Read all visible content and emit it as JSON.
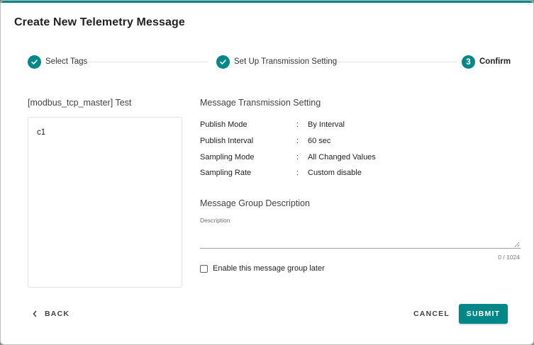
{
  "dialog": {
    "title": "Create New Telemetry Message",
    "accent_color": "#008787"
  },
  "stepper": {
    "steps": [
      {
        "number": "1",
        "label": "Select Tags",
        "state": "completed",
        "icon": "check-icon"
      },
      {
        "number": "2",
        "label": "Set Up Transmission Setting",
        "state": "completed",
        "icon": "check-icon"
      },
      {
        "number": "3",
        "label": "Confirm",
        "state": "active"
      }
    ]
  },
  "tags_panel": {
    "heading": "[modbus_tcp_master] Test",
    "items": [
      "c1"
    ]
  },
  "transmission": {
    "heading": "Message Transmission Setting",
    "rows": [
      {
        "key": "Publish Mode",
        "value": "By Interval"
      },
      {
        "key": "Publish Interval",
        "value": "60 sec"
      },
      {
        "key": "Sampling Mode",
        "value": "All Changed Values"
      },
      {
        "key": "Sampling Rate",
        "value": "Custom disable"
      }
    ]
  },
  "group_description": {
    "heading": "Message Group Description",
    "field_label": "Description",
    "value": "",
    "counter": "0 / 1024"
  },
  "enable_later": {
    "label": "Enable this message group later",
    "checked": false
  },
  "footer": {
    "back_label": "BACK",
    "cancel_label": "CANCEL",
    "submit_label": "SUBMIT"
  }
}
